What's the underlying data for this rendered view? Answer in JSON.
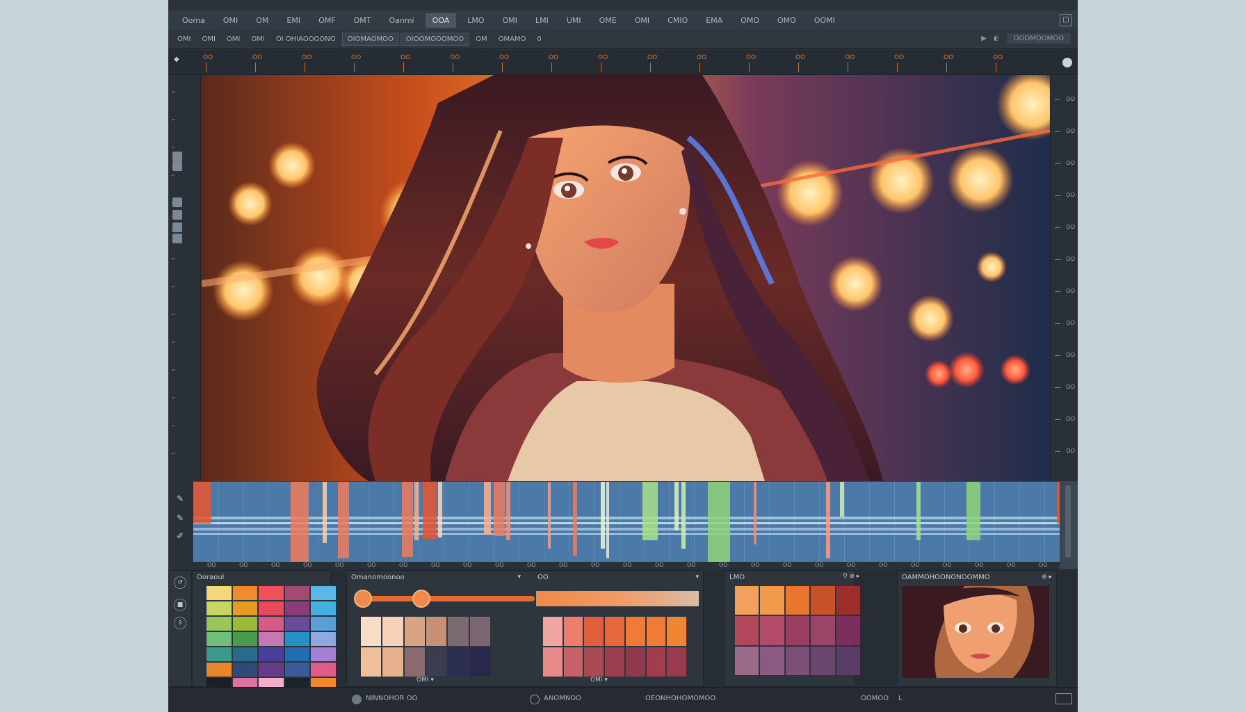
{
  "menubar": {
    "items": [
      {
        "label": "Ooma",
        "active": false
      },
      {
        "label": "OMI",
        "active": false
      },
      {
        "label": "OM",
        "active": false
      },
      {
        "label": "EMI",
        "active": false
      },
      {
        "label": "OMF",
        "active": false
      },
      {
        "label": "OMT",
        "active": false
      },
      {
        "label": "Oanmi",
        "active": false
      },
      {
        "label": "OOA",
        "active": true
      },
      {
        "label": "LMO",
        "active": false
      },
      {
        "label": "OMI",
        "active": false
      },
      {
        "label": "LMI",
        "active": false
      },
      {
        "label": "UMI",
        "active": false
      },
      {
        "label": "OME",
        "active": false
      },
      {
        "label": "OMI",
        "active": false
      },
      {
        "label": "CMIO",
        "active": false
      },
      {
        "label": "EMA",
        "active": false
      },
      {
        "label": "OMO",
        "active": false
      },
      {
        "label": "OMO",
        "active": false
      },
      {
        "label": "OOMI",
        "active": false
      }
    ],
    "window_button": "□"
  },
  "toolbar": {
    "items": [
      {
        "label": "OMI",
        "boxed": false
      },
      {
        "label": "OMI",
        "boxed": false
      },
      {
        "label": "OMI",
        "boxed": false
      },
      {
        "label": "OMI",
        "boxed": false
      },
      {
        "label": "OI OHIAOOOONO",
        "boxed": false
      },
      {
        "label": "OIOMAOMOO",
        "boxed": true
      },
      {
        "label": "OIOOMOOOMOO",
        "boxed": true
      },
      {
        "label": "OM",
        "boxed": false
      },
      {
        "label": "OMAMO",
        "boxed": false
      },
      {
        "label": "0",
        "boxed": false
      }
    ],
    "right": [
      "▶",
      "◐",
      "OOOMOOMOO"
    ]
  },
  "ruler": {
    "ticks": [
      "OO",
      "OO",
      "OO",
      "OO",
      "OO",
      "OO",
      "OO",
      "OO",
      "OO",
      "OO",
      "OO",
      "OO",
      "OO",
      "OO",
      "OO",
      "OO",
      "OO"
    ]
  },
  "right_ruler": {
    "ticks": [
      "OO",
      "OO",
      "OO",
      "OO",
      "OO",
      "OO",
      "OO",
      "OO",
      "OO",
      "OO",
      "OO",
      "OO"
    ]
  },
  "timeline_ruler": {
    "ticks": [
      "OO",
      "OO",
      "OO",
      "OO",
      "OO",
      "OO",
      "OO",
      "OO",
      "OO",
      "OO",
      "OO",
      "OO",
      "OO",
      "OO",
      "OO",
      "OO",
      "OO",
      "OO",
      "OO",
      "OO",
      "OO",
      "OO",
      "OO",
      "OO",
      "OO",
      "OO",
      "OO"
    ]
  },
  "panels": {
    "colors": {
      "title": "Ooraoul",
      "menu": ""
    },
    "gradient": {
      "title": "Omanomoonoo",
      "menu": "▾",
      "title2": "OO",
      "menu2": "▾",
      "marker1": "OMI ▾",
      "marker2": "OMI ▾"
    },
    "swatches": {
      "title": "LMO",
      "menu": "⚲ ⊕ ▸"
    },
    "reference": {
      "title": "OAMMOHOONONOOMMO",
      "menu": "⊕ ▸"
    }
  },
  "statusbar": {
    "items": [
      "NINNOHOR OO",
      "ANOMNOO",
      "OEONHOHOMOMOO",
      "OOMOO",
      "L"
    ]
  },
  "colors": {
    "accent_orange": "#e0702f",
    "timeline_blue": "#4b79a8",
    "app_bg": "#2b323a"
  },
  "palette_left": [
    "#f7d77a",
    "#f08a2c",
    "#f0525a",
    "#a34a72",
    "#5ab8e8",
    "#c7d562",
    "#e79a22",
    "#e8495e",
    "#8f3a78",
    "#44b0e0",
    "#9ac75a",
    "#9db93a",
    "#d85a86",
    "#6a4b9a",
    "#5a9ed8",
    "#6fbf7a",
    "#4a9a52",
    "#c47ab0",
    "#2790c8",
    "#8fa8e0",
    "#3c9a8a",
    "#2b6a8a",
    "#4a3f9a",
    "#1f6fb0",
    "#a87ed0",
    "#e8862a",
    "#2f4a7a",
    "#6a3a8a",
    "#3a5a9a",
    "#e05a8a",
    "#1a1e26",
    "#e070a0",
    "#f0b0c8",
    "#1c222a",
    "#f08a2c"
  ],
  "palette_mid_a": [
    "#f8dcc4",
    "#f5d2b8",
    "#d9a483",
    "#c98f72",
    "#7d6a70",
    "#7a6670",
    "#f0c09c",
    "#e6b08c",
    "#8a6a6e",
    "#3a3c50",
    "#2d2f52",
    "#28294a"
  ],
  "palette_mid_b": [
    "#f0a6a0",
    "#ec7e6a",
    "#e05f3e",
    "#e4683a",
    "#f07a36",
    "#ef7b34",
    "#f0862f",
    "#e98a8a",
    "#c96268",
    "#a94a52",
    "#9c3e50",
    "#8f3a4e",
    "#a23c50",
    "#9a3a4e"
  ],
  "palette_right": [
    "#f3a05c",
    "#f09a4a",
    "#e8762e",
    "#c8532a",
    "#9c2f2c",
    "#b0485a",
    "#b44a6a",
    "#9a3e62",
    "#9a4468",
    "#7a2f5c",
    "#9a6a8a",
    "#8a5a82",
    "#7a5078",
    "#6a4670",
    "#5a3d68"
  ]
}
